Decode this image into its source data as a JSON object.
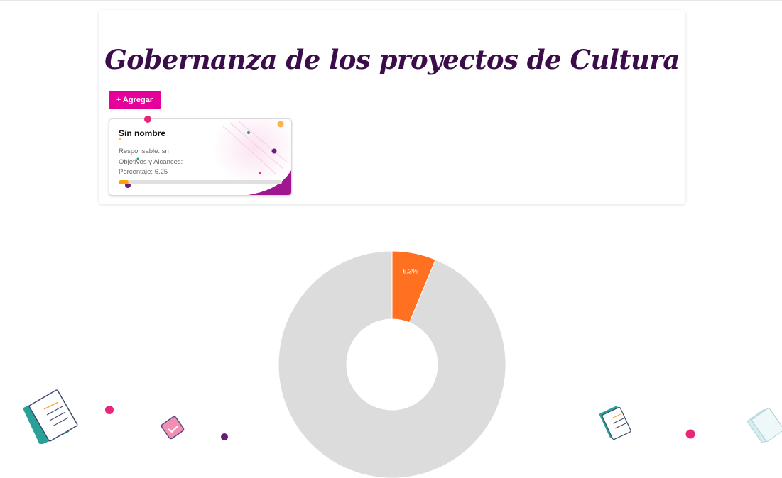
{
  "page": {
    "title": "Gobernanza de los proyectos de Cultura",
    "add_button_label": "+ Agregar"
  },
  "colors": {
    "title": "#3b0d4a",
    "accent": "#e6009a",
    "progress": "#ffa000",
    "chart_slice": "#ff7020",
    "chart_rest": "#dcdcdc"
  },
  "projects": [
    {
      "name": "Sin nombre",
      "responsable": "Responsable: sn",
      "objetivos": "Objetivos y Alcances:",
      "porcentaje_text": "Porcentaje: 6.25",
      "progress_percent": 6.25
    }
  ],
  "chart_data": {
    "type": "pie",
    "variant": "donut",
    "slices": [
      {
        "value": 6.25,
        "label": "6.3%",
        "color": "#ff7020"
      },
      {
        "value": 93.75,
        "label": "",
        "color": "#dcdcdc"
      }
    ]
  },
  "icons": [
    "document-stack-icon",
    "calendar-check-icon",
    "document-icon",
    "confetti-dot"
  ]
}
